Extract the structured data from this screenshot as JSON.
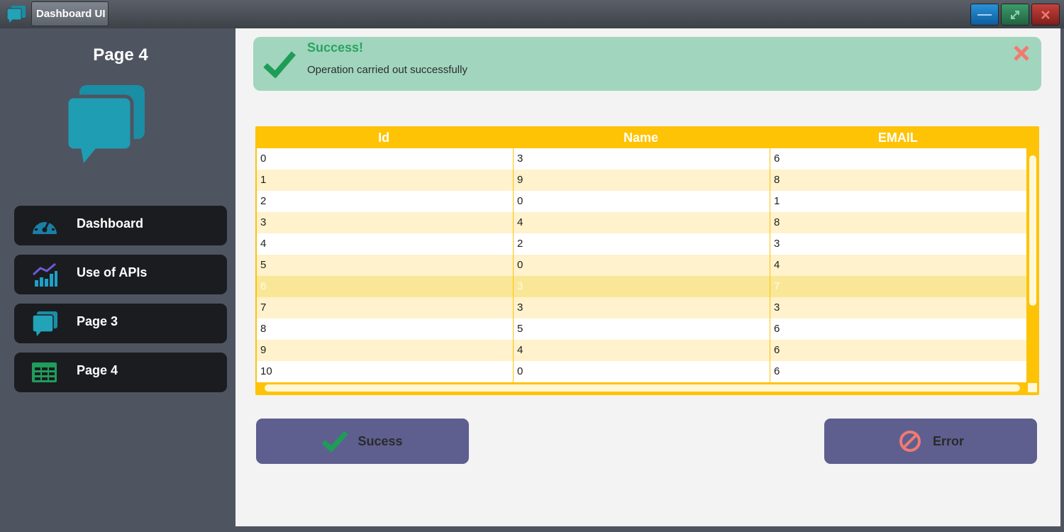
{
  "window": {
    "title": "Dashboard UI",
    "app_icon": "chat-bubbles-icon",
    "controls": [
      "minimize-icon",
      "maximize-icon",
      "close-icon"
    ]
  },
  "sidebar": {
    "title": "Page 4",
    "logo_icon": "chat-bubbles-icon",
    "items": [
      {
        "label": "Dashboard",
        "icon": "speedometer-icon"
      },
      {
        "label": "Use of APIs",
        "icon": "chart-icon"
      },
      {
        "label": "Page 3",
        "icon": "chat-bubbles-icon"
      },
      {
        "label": "Page 4",
        "icon": "table-icon"
      }
    ]
  },
  "alert": {
    "title": "Success!",
    "message": "Operation carried out successfully",
    "icon": "check-icon",
    "close_icon": "close-icon"
  },
  "table": {
    "columns": [
      "Id",
      "Name",
      "EMAIL"
    ],
    "rows": [
      [
        "0",
        "3",
        "6"
      ],
      [
        "1",
        "9",
        "8"
      ],
      [
        "2",
        "0",
        "1"
      ],
      [
        "3",
        "4",
        "8"
      ],
      [
        "4",
        "2",
        "3"
      ],
      [
        "5",
        "0",
        "4"
      ],
      [
        "6",
        "3",
        "7"
      ],
      [
        "7",
        "3",
        "3"
      ],
      [
        "8",
        "5",
        "6"
      ],
      [
        "9",
        "4",
        "6"
      ],
      [
        "10",
        "0",
        "6"
      ]
    ],
    "selected_row": 6
  },
  "buttons": {
    "success_label": "Sucess",
    "error_label": "Error"
  },
  "colors": {
    "table_header": "#fec304",
    "alert_bg": "#a2d5bd",
    "alert_title": "#27a561",
    "button_bg": "#5e5f8f",
    "sidebar_bg": "#4f5461",
    "nav_bg": "#1b1c20"
  }
}
